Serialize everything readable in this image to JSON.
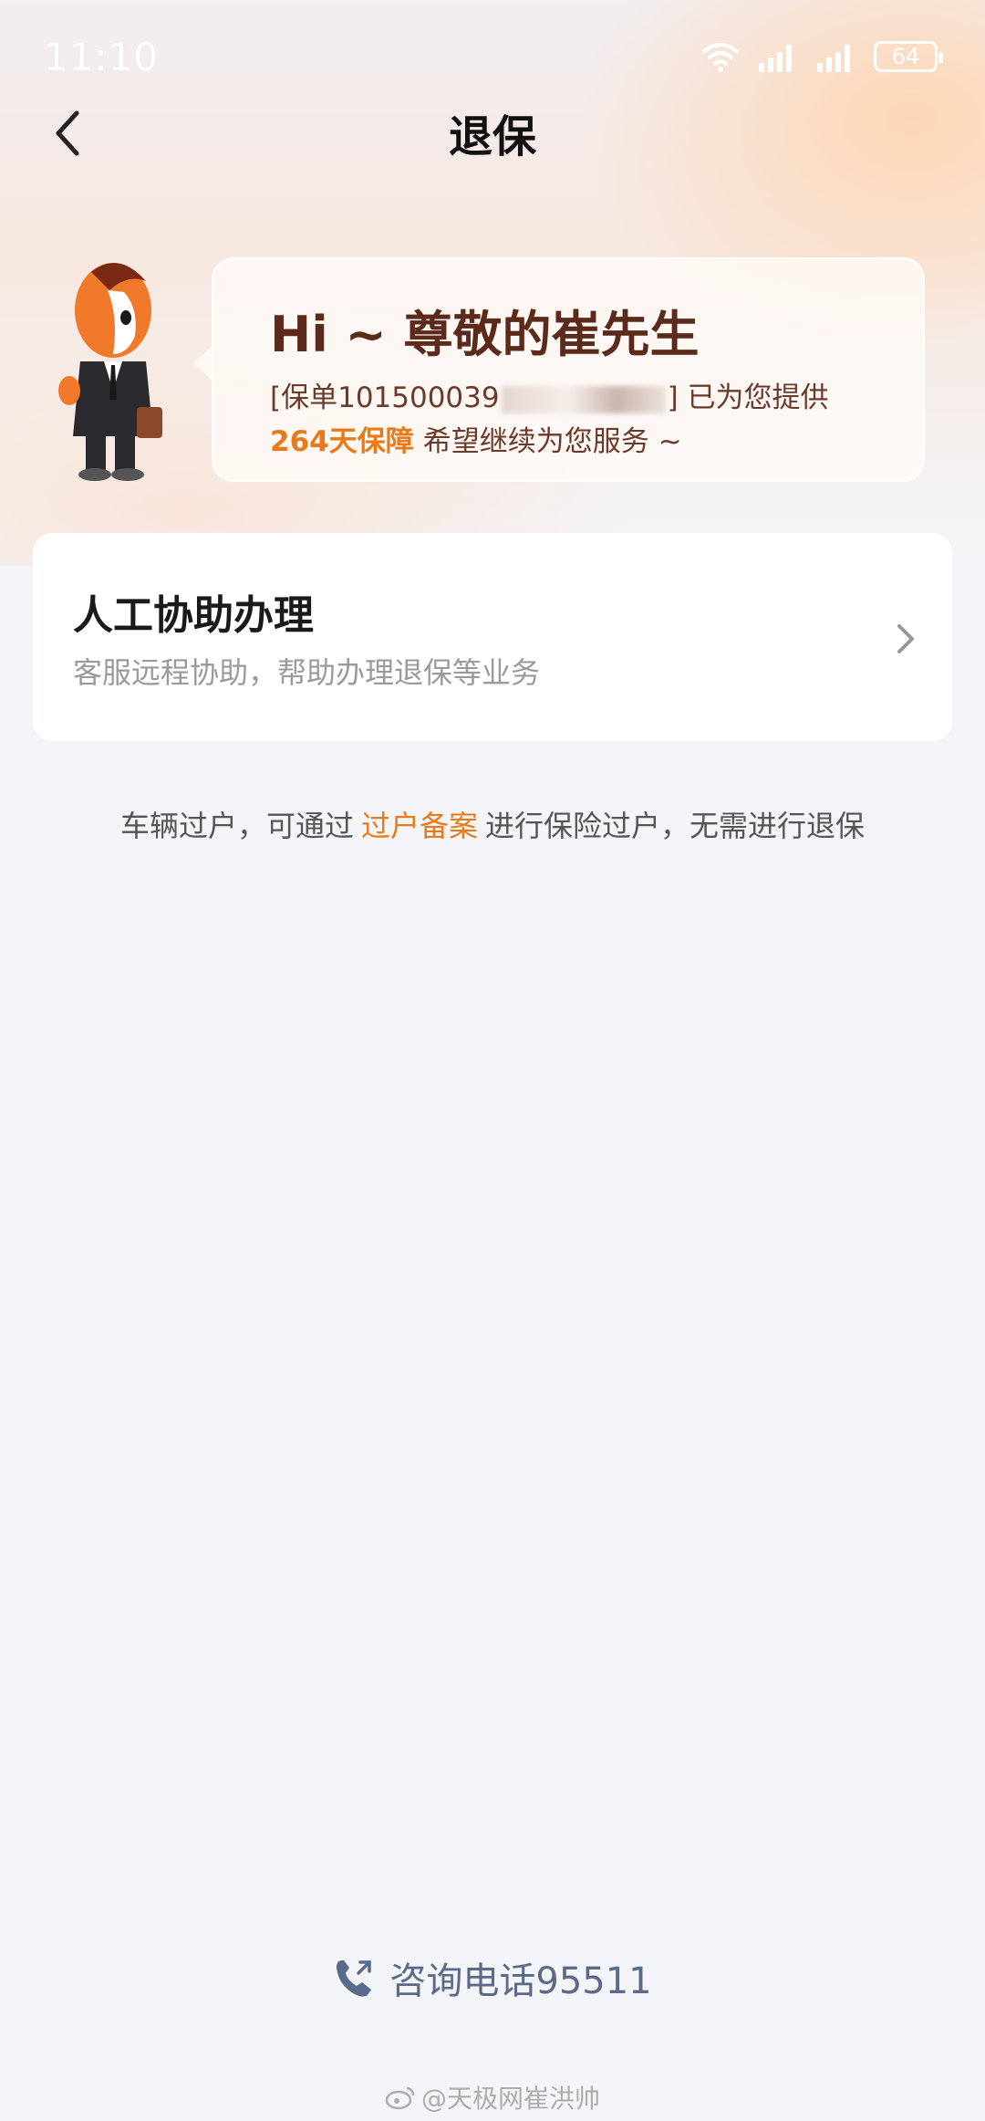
{
  "status_bar": {
    "time": "11:10",
    "battery": "64",
    "icons": [
      "wifi-icon",
      "signal-icon",
      "signal-icon",
      "battery-icon"
    ]
  },
  "nav": {
    "back_icon": "chevron-left-icon",
    "title": "退保"
  },
  "greeting_card": {
    "greeting": "Hi ~ 尊敬的崔先生",
    "policy_prefix": "[保单101500039",
    "policy_suffix": "] 已为您提供",
    "days": "264天保障",
    "service_text": "希望继续为您服务 ~"
  },
  "assist_card": {
    "title": "人工协助办理",
    "subtitle": "客服远程协助，帮助办理退保等业务",
    "icon": "chevron-right-icon"
  },
  "notice": {
    "prefix": "车辆过户，可通过",
    "link": "过户备案",
    "suffix": "进行保险过户，无需进行退保"
  },
  "footer": {
    "consult_label": "咨询电话95511",
    "consult_icon": "phone-icon",
    "watermark": "@天极网崔洪帅"
  },
  "colors": {
    "accent": "#e87a1a",
    "greeting_text": "#5c2a1a",
    "consult_text": "#5a6a8a",
    "background": "#f4f5f8"
  }
}
